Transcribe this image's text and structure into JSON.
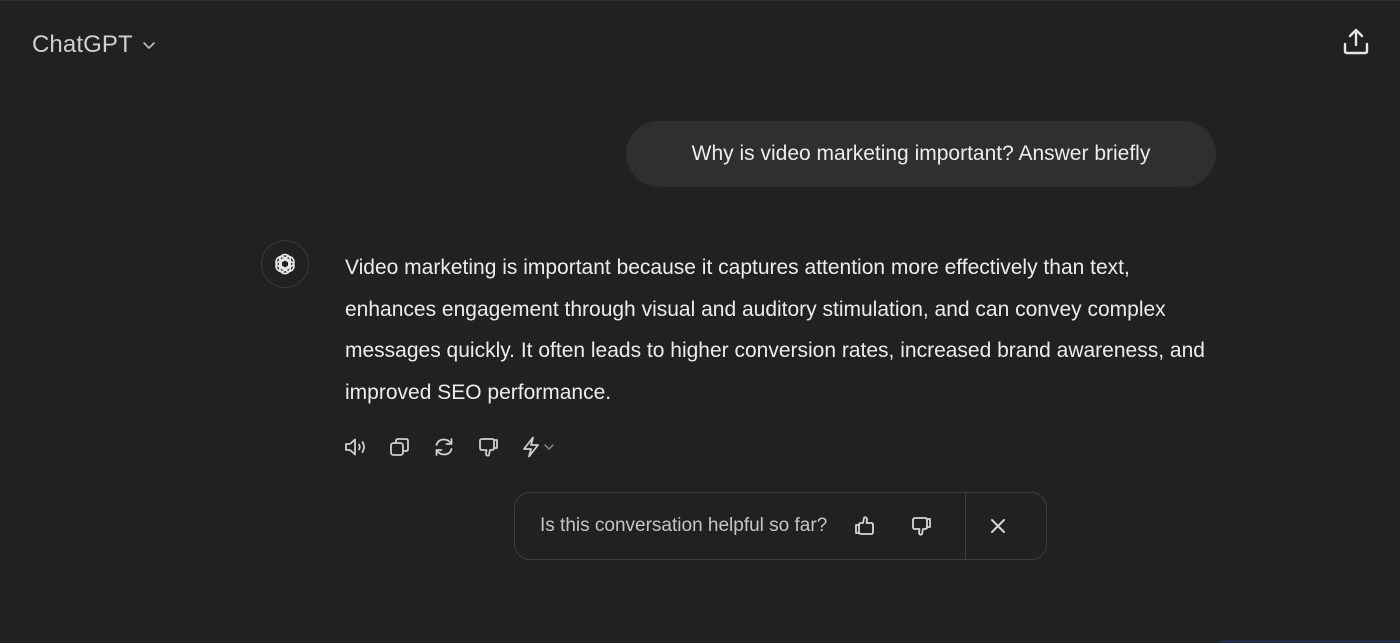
{
  "header": {
    "model_name": "ChatGPT",
    "chevron_icon": "chevron-down-icon",
    "share_icon": "share-icon"
  },
  "conversation": {
    "user_message": "Why is video marketing important? Answer briefly",
    "assistant_avatar_icon": "openai-logo-icon",
    "assistant_message": "Video marketing is important because it captures attention more effectively than text, enhances engagement through visual and auditory stimulation, and can convey complex messages quickly. It often leads to higher conversion rates, increased brand awareness, and improved SEO performance.",
    "actions": [
      {
        "name": "read-aloud-button",
        "icon": "speaker-icon"
      },
      {
        "name": "copy-button",
        "icon": "copy-icon"
      },
      {
        "name": "regenerate-button",
        "icon": "refresh-icon"
      },
      {
        "name": "bad-response-button",
        "icon": "thumbs-down-icon"
      },
      {
        "name": "switch-model-button",
        "icon": "lightning-icon"
      }
    ]
  },
  "feedback": {
    "question": "Is this conversation helpful so far?",
    "thumbs_up_icon": "thumbs-up-icon",
    "thumbs_down_icon": "thumbs-down-icon",
    "close_icon": "close-icon"
  },
  "colors": {
    "background": "#212121",
    "user_bubble": "#2f2f2f",
    "text": "#ececec",
    "muted_text": "#c5c5c5",
    "border": "#3d3d3d"
  }
}
